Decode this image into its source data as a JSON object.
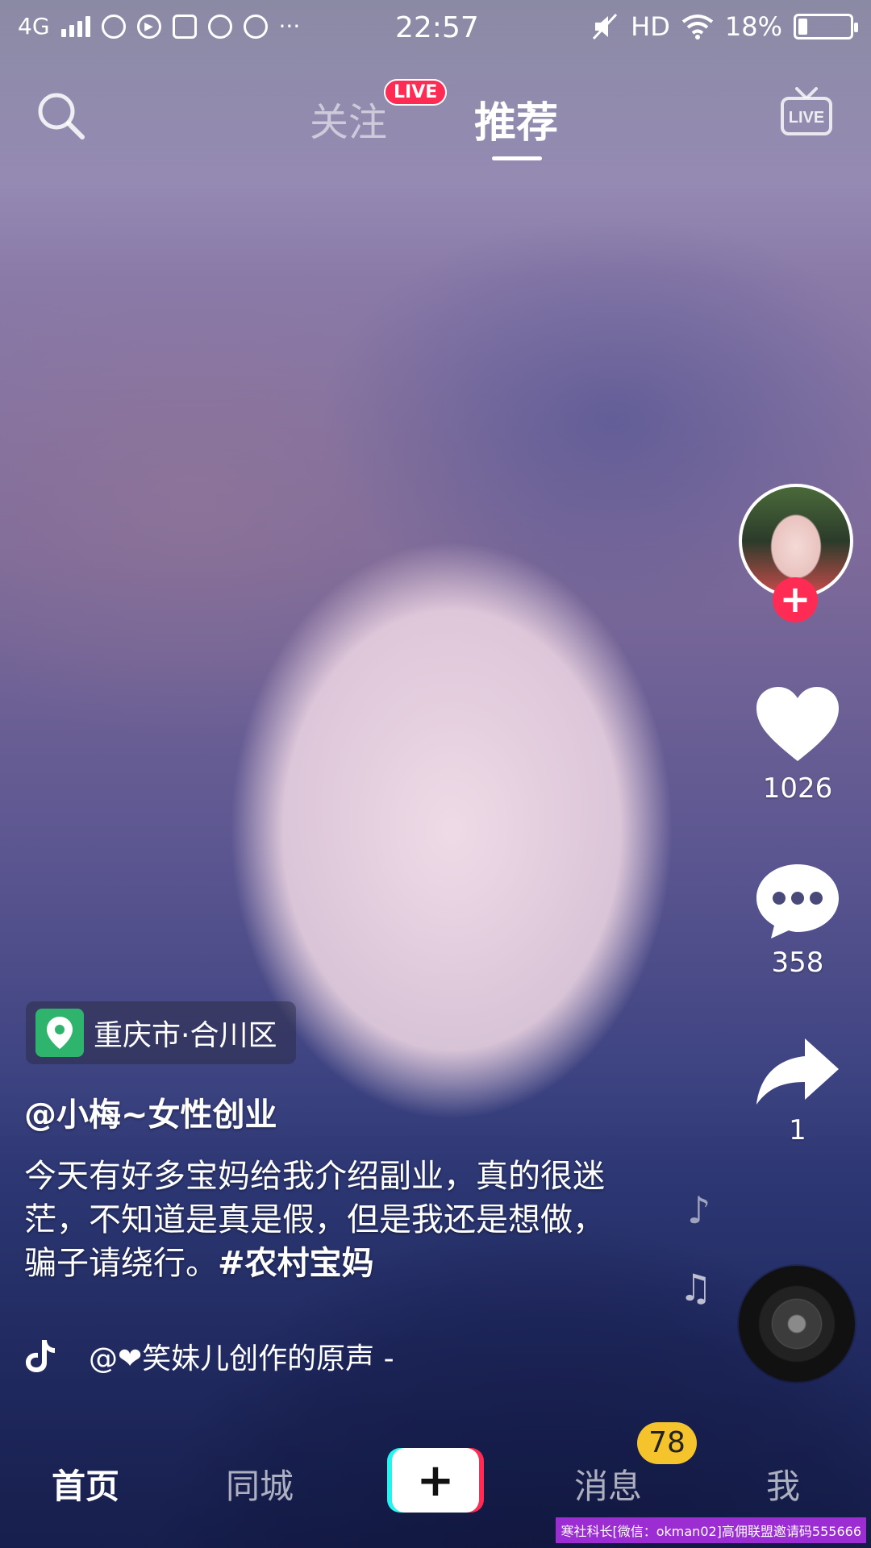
{
  "status_bar": {
    "network": "4G",
    "app_icons": [
      "planet-icon",
      "play-icon",
      "tencent-icon",
      "qq-icon",
      "qq-icon"
    ],
    "more": "···",
    "time": "22:57",
    "hd": "HD",
    "battery_percent": "18%",
    "battery_level": 0.18
  },
  "top_nav": {
    "follow_tab": "关注",
    "live_badge": "LIVE",
    "recommend_tab": "推荐",
    "live_button_text": "LIVE"
  },
  "right_rail": {
    "like_count": "1026",
    "comment_count": "358",
    "share_count": "1"
  },
  "video": {
    "location": "重庆市·合川区",
    "author": "@小梅~女性创业",
    "caption_text": "今天有好多宝妈给我介绍副业，真的很迷茫，不知道是真是假，但是我还是想做，骗子请绕行。",
    "hashtag": "#农村宝妈",
    "music": "@❤笑妹儿创作的原声 -"
  },
  "tab_bar": {
    "home": "首页",
    "city": "同城",
    "create": "+",
    "messages": "消息",
    "messages_badge": "78",
    "me": "我"
  },
  "watermark": "寒社科长[微信：okman02]高佣联盟邀请码555666",
  "colors": {
    "accent_red": "#fe2c55",
    "accent_cyan": "#25f4ee",
    "badge_yellow": "#f5c42c",
    "location_green": "#2fb46e"
  }
}
